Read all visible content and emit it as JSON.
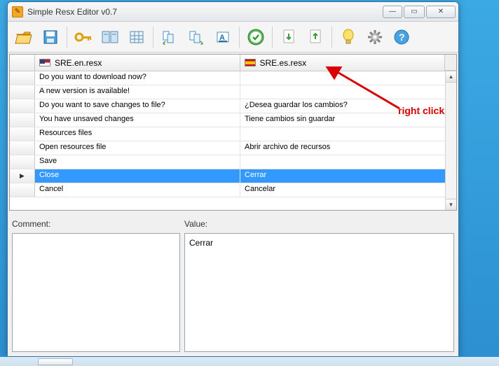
{
  "window": {
    "title": "Simple Resx Editor v0.7"
  },
  "columns": {
    "left": "SRE.en.resx",
    "right": "SRE.es.resx"
  },
  "rows": [
    {
      "en": "Do you want to download now?",
      "es": ""
    },
    {
      "en": "A new version is available!",
      "es": ""
    },
    {
      "en": "Do you want to save changes to file?",
      "es": "¿Desea guardar los cambios?"
    },
    {
      "en": "You have unsaved changes",
      "es": "Tiene cambios sin guardar"
    },
    {
      "en": "Resources files",
      "es": ""
    },
    {
      "en": "Open resources file",
      "es": "Abrir archivo de recursos"
    },
    {
      "en": "Save",
      "es": ""
    },
    {
      "en": "Close",
      "es": "Cerrar",
      "selected": true,
      "current": true
    },
    {
      "en": "Cancel",
      "es": "Cancelar"
    }
  ],
  "panels": {
    "comment_label": "Comment:",
    "value_label": "Value:",
    "value_text": "Cerrar"
  },
  "annotation": {
    "text": "right click"
  },
  "toolbar_icons": [
    "open-icon",
    "save-icon",
    "key-icon",
    "compare-icon",
    "grid-icon",
    "copy-left-icon",
    "copy-right-icon",
    "highlight-icon",
    "ok-icon",
    "import-icon",
    "export-icon",
    "tip-icon",
    "settings-icon",
    "help-icon"
  ]
}
